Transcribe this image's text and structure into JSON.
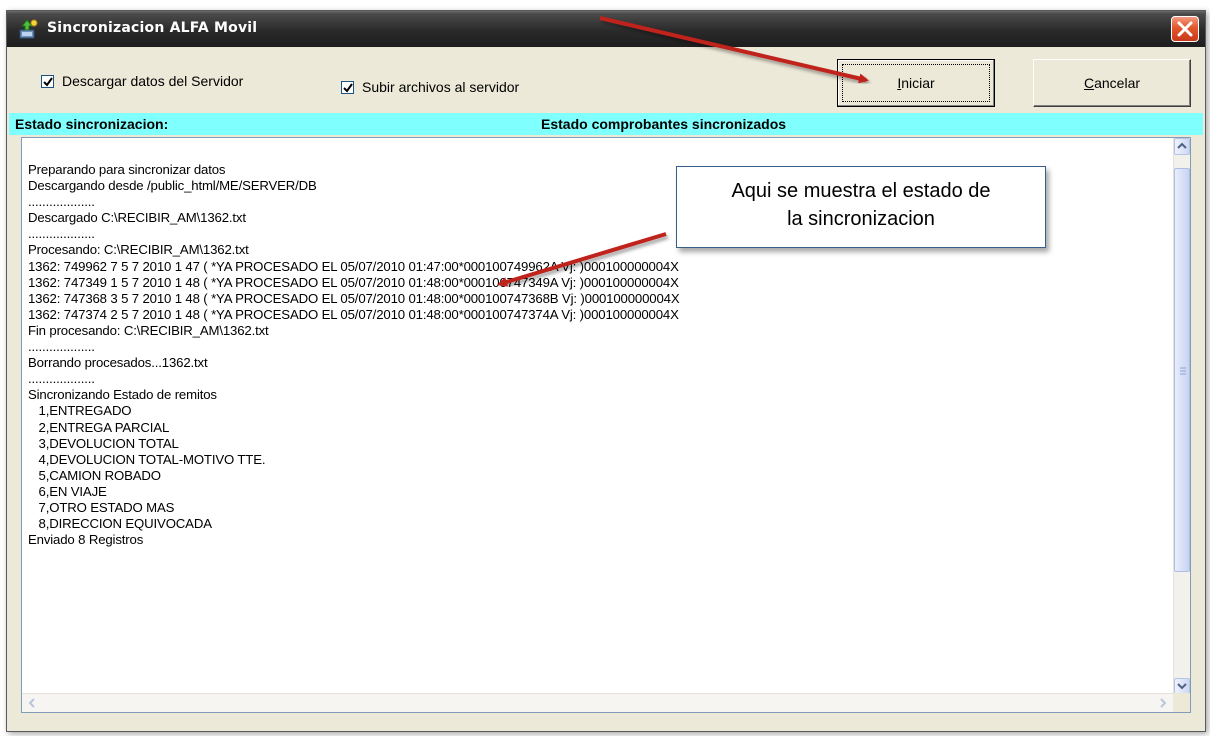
{
  "window": {
    "title": "Sincronizacion ALFA Movil",
    "close_icon": "close-icon"
  },
  "toolbar": {
    "download_checkbox": {
      "label": "Descargar datos del Servidor",
      "checked": true
    },
    "upload_checkbox": {
      "label": "Subir archivos al servidor",
      "checked": true
    },
    "start_button": {
      "label_rest": "niciar",
      "label_mnemonic": "I"
    },
    "cancel_button": {
      "label_rest": "ancelar",
      "label_mnemonic": "C"
    }
  },
  "status_header": {
    "sync_status_label": "Estado sincronizacion:",
    "receipts_status_label": "Estado comprobantes sincronizados"
  },
  "log": {
    "lines": [
      "Preparando para sincronizar datos",
      "Descargando desde /public_html/ME/SERVER/DB",
      "...................",
      "Descargado C:\\RECIBIR_AM\\1362.txt",
      "...................",
      "Procesando: C:\\RECIBIR_AM\\1362.txt",
      "1362: 749962 7 5 7 2010 1 47 ( *YA PROCESADO EL 05/07/2010 01:47:00*000100749962A Vj: )000100000004X",
      "1362: 747349 1 5 7 2010 1 48 ( *YA PROCESADO EL 05/07/2010 01:48:00*000100747349A Vj: )000100000004X",
      "1362: 747368 3 5 7 2010 1 48 ( *YA PROCESADO EL 05/07/2010 01:48:00*000100747368B Vj: )000100000004X",
      "1362: 747374 2 5 7 2010 1 48 ( *YA PROCESADO EL 05/07/2010 01:48:00*000100747374A Vj: )000100000004X",
      "Fin procesando: C:\\RECIBIR_AM\\1362.txt",
      "...................",
      "Borrando procesados...1362.txt",
      "...................",
      "Sincronizando Estado de remitos",
      "   1,ENTREGADO",
      "   2,ENTREGA PARCIAL",
      "   3,DEVOLUCION TOTAL",
      "   4,DEVOLUCION TOTAL-MOTIVO TTE.",
      "   5,CAMION ROBADO",
      "   6,EN VIAJE",
      "   7,OTRO ESTADO MAS",
      "   8,DIRECCION EQUIVOCADA",
      "Enviado 8 Registros"
    ]
  },
  "callout": {
    "line1": "Aqui se muestra el estado de",
    "line2": "la sincronizacion"
  },
  "colors": {
    "status_header_bg": "#80ffff",
    "annotation_arrow": "#c0201c",
    "callout_border": "#385d8a"
  }
}
